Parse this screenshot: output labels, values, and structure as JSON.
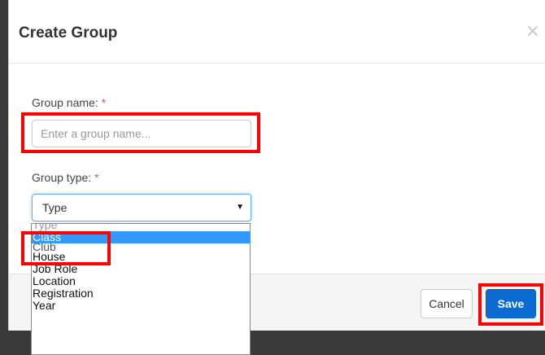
{
  "modal": {
    "title": "Create Group",
    "close_glyph": "×",
    "close_icon": "close-icon"
  },
  "form": {
    "group_name_label": "Group name:",
    "group_name_required": "*",
    "group_name_value": "",
    "group_name_placeholder": "Enter a group name...",
    "group_type_label": "Group type:",
    "group_type_required": "*",
    "group_type_selected": "Type",
    "caret_glyph": "▼",
    "caret_icon": "caret-down-icon"
  },
  "dropdown": {
    "options": [
      "Type",
      "Class",
      "Club",
      "House",
      "Job Role",
      "Location",
      "Registration",
      "Year"
    ],
    "highlighted": "Class"
  },
  "footer": {
    "cancel_label": "Cancel",
    "save_label": "Save"
  },
  "colors": {
    "highlight_box": "#ff0000",
    "save_button": "#0b6bd3",
    "selected_option": "#3399ff",
    "required_marker": "#d9534f"
  },
  "annotations": {
    "count": 3,
    "targets": [
      "group-name-input",
      "dropdown-option-class",
      "save-button"
    ]
  }
}
